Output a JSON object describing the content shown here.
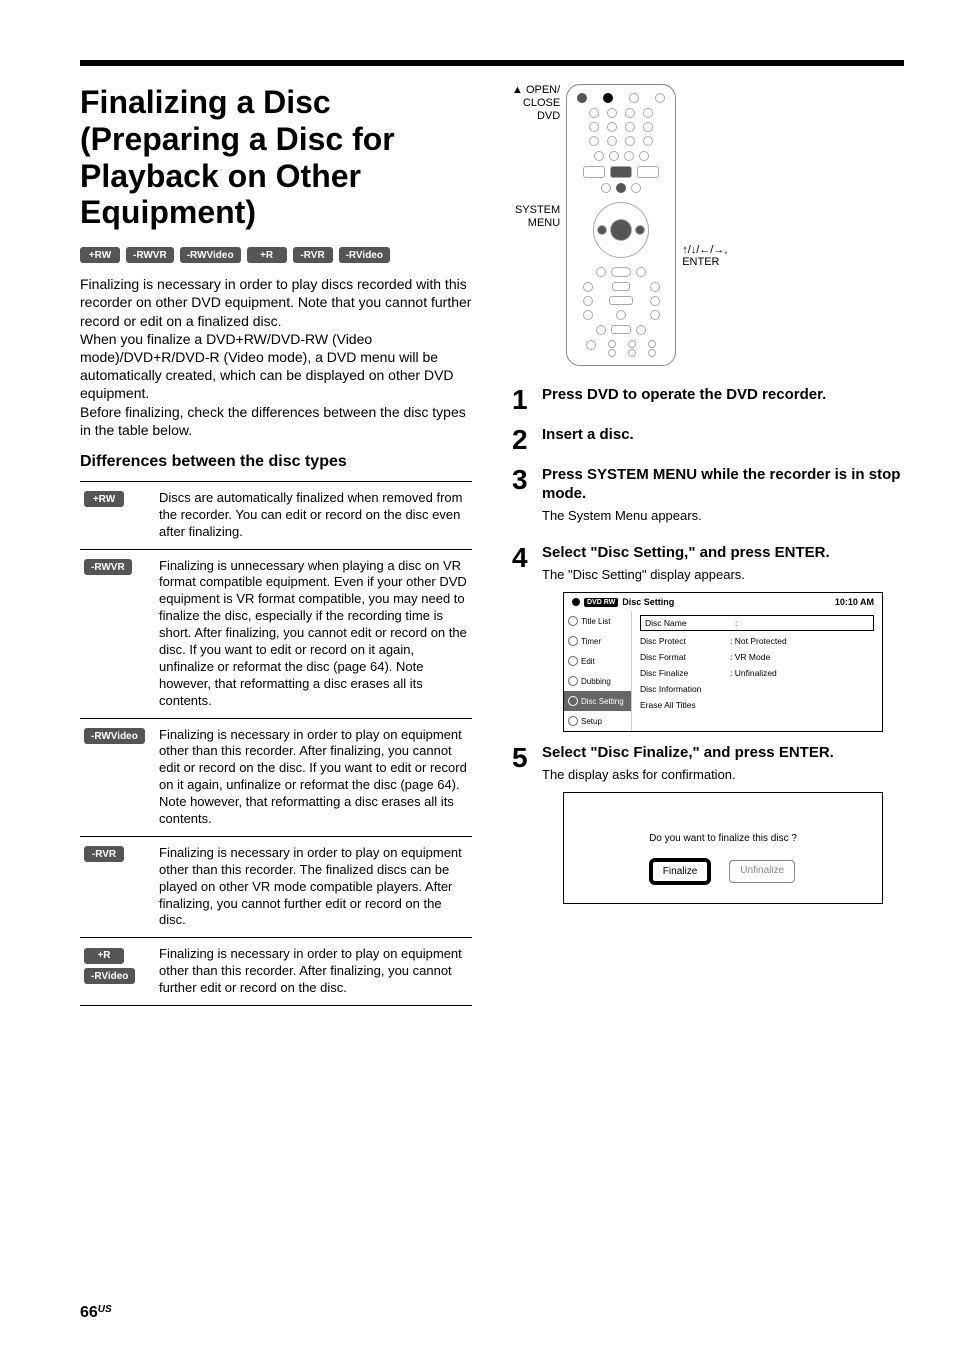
{
  "page": {
    "number": "66",
    "suffix": "US"
  },
  "title": "Finalizing a Disc (Preparing a Disc for Playback on Other Equipment)",
  "badges_top": [
    "+RW",
    "-RWVR",
    "-RWVideo",
    "+R",
    "-RVR",
    "-RVideo"
  ],
  "intro_paragraph": "Finalizing is necessary in order to play discs recorded with this recorder on other DVD equipment. Note that you cannot further record or edit on a finalized disc.\nWhen you finalize a DVD+RW/DVD-RW (Video mode)/DVD+R/DVD-R (Video mode), a DVD menu will be automatically created, which can be displayed on other DVD equipment.\nBefore finalizing, check the differences between the disc types in the table below.",
  "subhead": "Differences between the disc types",
  "disc_table": [
    {
      "badges": [
        "+RW"
      ],
      "text": "Discs are automatically finalized when removed from the recorder. You can edit or record on the disc even after finalizing."
    },
    {
      "badges": [
        "-RWVR"
      ],
      "text": "Finalizing is unnecessary when playing a disc on VR format compatible equipment. Even if your other DVD equipment is VR format compatible, you may need to finalize the disc, especially if the recording time is short. After finalizing, you cannot edit or record on the disc. If you want to edit or record on it again, unfinalize or reformat the disc (page 64). Note however, that reformatting a disc erases all its contents."
    },
    {
      "badges": [
        "-RWVideo"
      ],
      "text": "Finalizing is necessary in order to play on equipment other than this recorder. After finalizing, you cannot edit or record on the disc. If you want to edit or record on it again, unfinalize or reformat the disc (page 64). Note however, that reformatting a disc erases all its contents."
    },
    {
      "badges": [
        "-RVR"
      ],
      "text": "Finalizing is necessary in order to play on equipment other than this recorder. The finalized discs can be played on other VR mode compatible players. After finalizing, you cannot further edit or record on the disc."
    },
    {
      "badges": [
        "+R",
        "-RVideo"
      ],
      "text": "Finalizing is necessary in order to play on equipment other than this recorder. After finalizing, you cannot further edit or record on the disc."
    }
  ],
  "remote_labels": {
    "open_close": "OPEN/\nCLOSE",
    "dvd": "DVD",
    "system_menu": "SYSTEM\nMENU",
    "arrows_enter": "↑/↓/←/→,\nENTER",
    "eject_symbol": "▲"
  },
  "steps": [
    {
      "num": "1",
      "head": "Press DVD to operate the DVD recorder.",
      "sub": ""
    },
    {
      "num": "2",
      "head": "Insert a disc.",
      "sub": ""
    },
    {
      "num": "3",
      "head": "Press SYSTEM MENU while the recorder is in stop mode.",
      "sub": "The System Menu appears."
    },
    {
      "num": "4",
      "head": "Select \"Disc Setting,\" and press ENTER.",
      "sub": "The \"Disc Setting\" display appears."
    },
    {
      "num": "5",
      "head": "Select \"Disc Finalize,\" and press ENTER.",
      "sub": "The display asks for confirmation."
    }
  ],
  "disc_setting_screen": {
    "title": "Disc Setting",
    "dvd_badge": "DVD RW",
    "time": "10:10 AM",
    "sidebar": [
      {
        "label": "Title List",
        "active": false
      },
      {
        "label": "Timer",
        "active": false
      },
      {
        "label": "Edit",
        "active": false
      },
      {
        "label": "Dubbing",
        "active": false
      },
      {
        "label": "Disc Setting",
        "active": true
      },
      {
        "label": "Setup",
        "active": false
      }
    ],
    "rows": [
      {
        "key": "Disc Name",
        "val": "",
        "boxed": true,
        "novalue": false
      },
      {
        "key": "Disc Protect",
        "val": "Not Protected",
        "boxed": false
      },
      {
        "key": "Disc Format",
        "val": "VR Mode",
        "boxed": false
      },
      {
        "key": "Disc Finalize",
        "val": "Unfinalized",
        "boxed": false
      },
      {
        "key": "Disc Information",
        "val": "",
        "boxed": false,
        "novalue": true
      },
      {
        "key": "Erase All Titles",
        "val": "",
        "boxed": false,
        "novalue": true
      }
    ]
  },
  "finalize_dialog": {
    "prompt": "Do you want to finalize this disc ?",
    "primary": "Finalize",
    "secondary": "Unfinalize"
  }
}
